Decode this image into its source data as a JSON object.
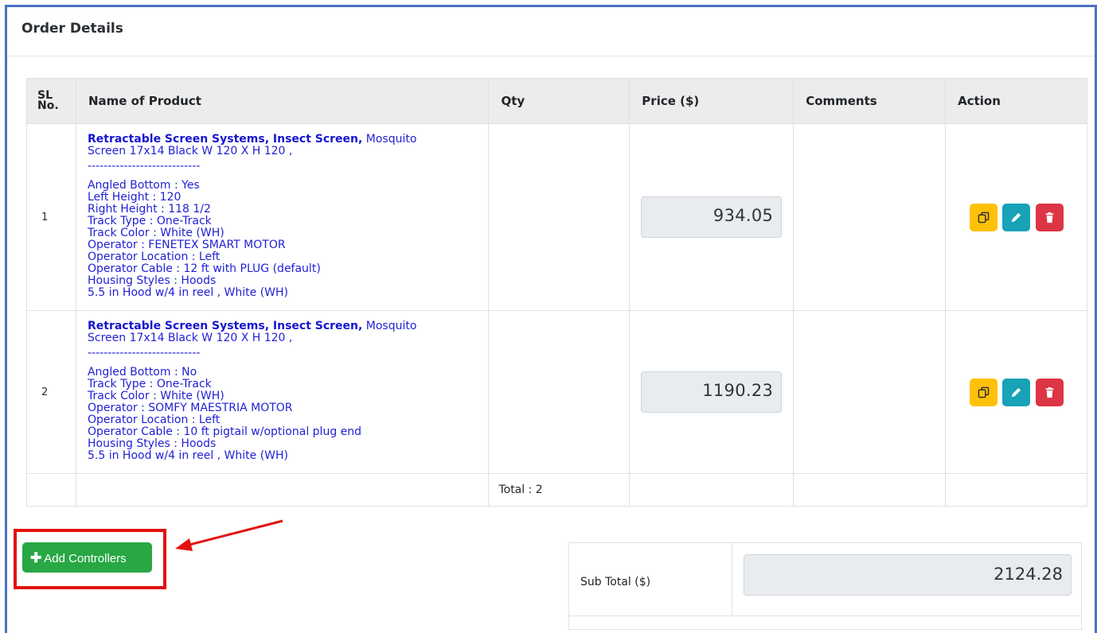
{
  "card": {
    "title": "Order Details"
  },
  "table": {
    "headers": {
      "sl_line1": "SL",
      "sl_line2": "No.",
      "product": "Name of Product",
      "qty": "Qty",
      "price": "Price ($)",
      "comments": "Comments",
      "action": "Action"
    },
    "rows": [
      {
        "sl": "1",
        "product_name": "Retractable Screen Systems, Insect Screen,",
        "product_desc_a": " Mosquito",
        "product_desc_b": "Screen 17x14 Black W 120 X H 120 ,",
        "separator": "----------------------------",
        "specs": [
          "Angled Bottom : Yes",
          "Left Height : 120",
          "Right Height : 118 1/2",
          "Track Type : One-Track",
          "Track Color : White (WH)",
          "Operator : FENETEX SMART MOTOR",
          "Operator Location : Left",
          "Operator Cable : 12 ft with PLUG (default)",
          "Housing Styles : Hoods",
          "5.5 in Hood w/4 in reel , White (WH)"
        ],
        "qty": "",
        "price": "934.05",
        "comments": ""
      },
      {
        "sl": "2",
        "product_name": "Retractable Screen Systems, Insect Screen,",
        "product_desc_a": " Mosquito",
        "product_desc_b": "Screen 17x14 Black W 120 X H 120 ,",
        "separator": "----------------------------",
        "specs": [
          "Angled Bottom : No",
          "Track Type : One-Track",
          "Track Color : White (WH)",
          "Operator : SOMFY MAESTRIA MOTOR",
          "Operator Location : Left",
          "Operator Cable : 10 ft pigtail w/optional plug end",
          "Housing Styles : Hoods",
          "5.5 in Hood w/4 in reel , White (WH)"
        ],
        "qty": "",
        "price": "1190.23",
        "comments": ""
      }
    ],
    "total_label": "Total : 2"
  },
  "actions": {
    "add_controllers_label": "Add Controllers"
  },
  "icons": {
    "copy": "copy-icon",
    "edit": "pencil-icon",
    "delete": "trash-icon",
    "plus": "plus-icon"
  },
  "summary": {
    "subtotal_label": "Sub Total ($)",
    "subtotal_value": "2124.28"
  },
  "colors": {
    "frame": "#4a72c4",
    "copy_button": "#ffc107",
    "edit_button": "#17a2b8",
    "delete_button": "#dc3545",
    "add_button": "#28a745",
    "annotation": "#e21111",
    "product_text": "#1515d0"
  }
}
